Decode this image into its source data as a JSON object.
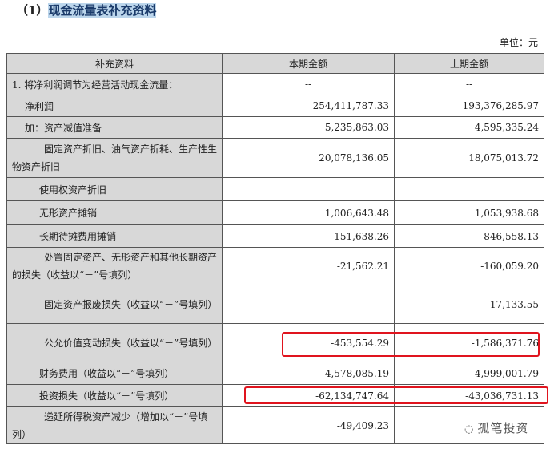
{
  "title_prefix": "（1）",
  "title": "现金流量表补充资料",
  "unit": "单位：元",
  "headers": [
    "补充资料",
    "本期金额",
    "上期金额"
  ],
  "rows": [
    {
      "label": "1. 将净利润调节为经营活动现金流量：",
      "cur": "--",
      "prev": "--"
    },
    {
      "label": "净利润",
      "cur": "254,411,787.33",
      "prev": "193,376,285.97"
    },
    {
      "label": "加：资产减值准备",
      "cur": "5,235,863.03",
      "prev": "4,595,335.24"
    },
    {
      "label": "固定资产折旧、油气资产折耗、生产性生物资产折旧",
      "cur": "20,078,136.05",
      "prev": "18,075,013.72"
    },
    {
      "label": "使用权资产折旧",
      "cur": "",
      "prev": ""
    },
    {
      "label": "无形资产摊销",
      "cur": "1,006,643.48",
      "prev": "1,053,938.68"
    },
    {
      "label": "长期待摊费用摊销",
      "cur": "151,638.26",
      "prev": "846,558.13"
    },
    {
      "label": "处置固定资产、无形资产和其他长期资产的损失（收益以“－”号填列）",
      "cur": "-21,562.21",
      "prev": "-160,059.20"
    },
    {
      "label": "固定资产报废损失（收益以“－”号填列）",
      "cur": "",
      "prev": "17,133.55"
    },
    {
      "label": "公允价值变动损失（收益以“－”号填列）",
      "cur": "-453,554.29",
      "prev": "-1,586,371.76"
    },
    {
      "label": "财务费用（收益以“－”号填列）",
      "cur": "4,578,085.19",
      "prev": "4,999,001.79"
    },
    {
      "label": "投资损失（收益以“－”号填列）",
      "cur": "-62,134,747.64",
      "prev": "-43,036,731.13"
    },
    {
      "label": "递延所得税资产减少（增加以“－”号填列）",
      "cur": "-49,409.23",
      "prev": ""
    }
  ],
  "watermark": "孤笔投资",
  "highlight_color": "#e0141e"
}
